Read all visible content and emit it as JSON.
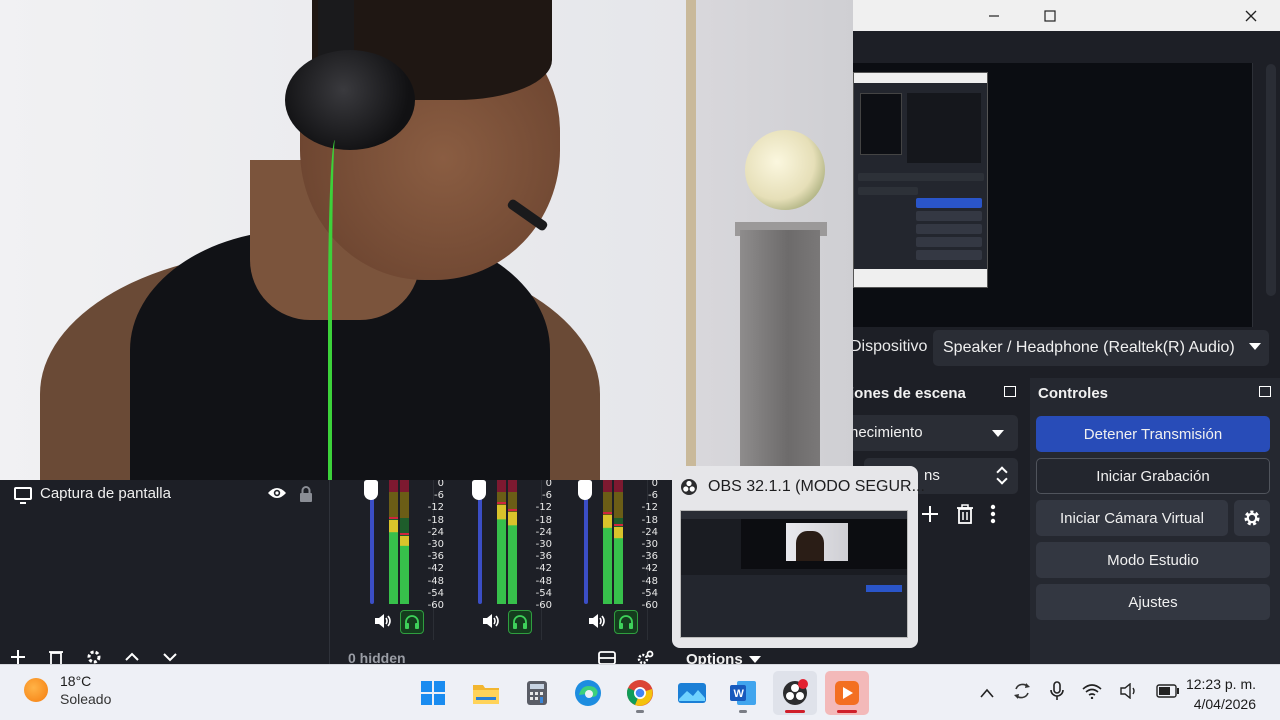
{
  "window": {
    "title_controls": [
      "minimize",
      "maximize",
      "close"
    ]
  },
  "audio_device": {
    "label": "Dispositivo",
    "value": "Speaker / Headphone (Realtek(R) Audio)"
  },
  "transitions": {
    "title": "iones de escena",
    "selected": "necimiento",
    "duration": "ns"
  },
  "controls": {
    "title": "Controles",
    "buttons": {
      "stop_stream": "Detener Transmisión",
      "start_recording": "Iniciar Grabación",
      "start_virtualcam": "Iniciar Cámara Virtual",
      "studio_mode": "Modo Estudio",
      "settings": "Ajustes"
    }
  },
  "sources": {
    "items": [
      {
        "name": "Captura de pantalla",
        "visible": true,
        "locked": false
      }
    ]
  },
  "mixer": {
    "scale": [
      "0",
      "-6",
      "-12",
      "-18",
      "-24",
      "-30",
      "-36",
      "-42",
      "-48",
      "-54",
      "-60"
    ],
    "channels": [
      {
        "level_a": 0.68,
        "level_b": 0.55
      },
      {
        "level_a": 0.8,
        "level_b": 0.74
      },
      {
        "level_a": 0.72,
        "level_b": 0.62
      }
    ],
    "hidden_text": "0 hidden",
    "options_label": "Options"
  },
  "taskbar_preview": {
    "title": "OBS 32.1.1 (MODO SEGUR..."
  },
  "taskbar": {
    "weather": {
      "temp": "18°C",
      "condition": "Soleado"
    },
    "apps": [
      "windows-start",
      "file-explorer",
      "calculator",
      "edge",
      "chrome",
      "photos",
      "word",
      "obs",
      "video-editor"
    ],
    "clock": {
      "time": "12:23 p. m.",
      "date": "4/04/2026"
    }
  },
  "colors": {
    "accent_blue": "#284cb8",
    "panel_bg": "#1d1f26",
    "meter_green": "#37c04b",
    "meter_yellow": "#d9c32b",
    "meter_red": "#d0263e"
  }
}
